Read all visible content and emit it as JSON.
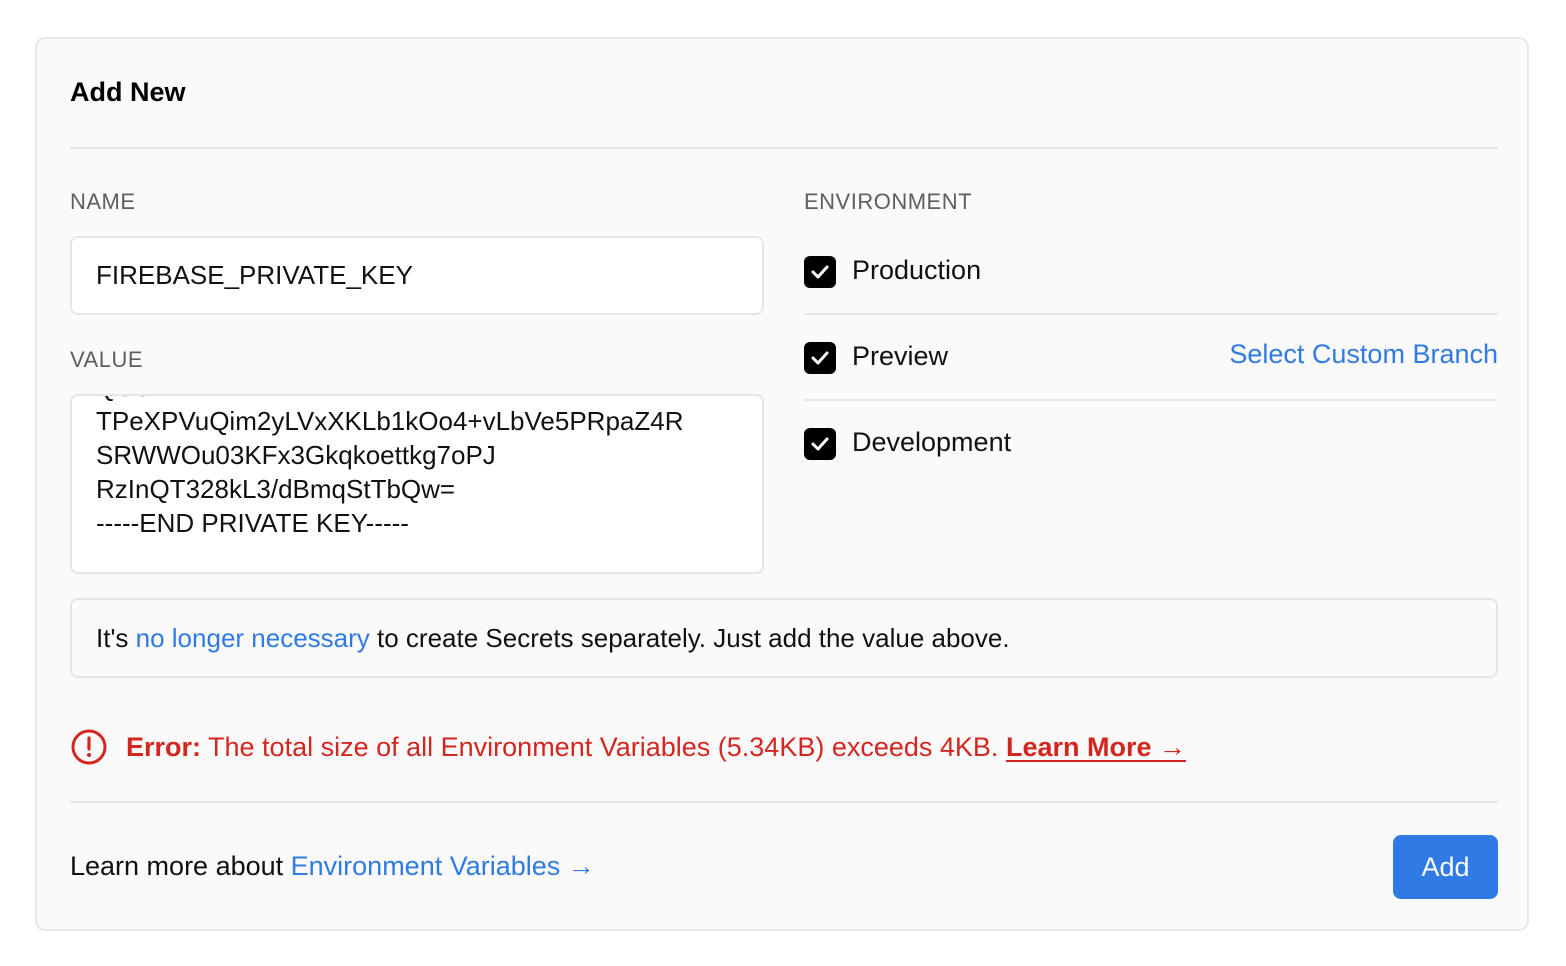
{
  "form": {
    "title": "Add New",
    "name_label": "NAME",
    "name_value": "FIREBASE_PRIVATE_KEY",
    "value_label": "VALUE",
    "value_lines": [
      "QUeD...",
      "TPeXPVuQim2yLVxXKLb1kOo4+vLbVe5PRpaZ4R",
      "SRWWOu03KFx3Gkqkoettkg7oPJ",
      "RzInQT328kL3/dBmqStTbQw=",
      "-----END PRIVATE KEY-----"
    ],
    "environment_label": "ENVIRONMENT",
    "environments": [
      {
        "label": "Production",
        "checked": true
      },
      {
        "label": "Preview",
        "checked": true
      },
      {
        "label": "Development",
        "checked": true
      }
    ],
    "custom_branch_label": "Select Custom Branch"
  },
  "notice": {
    "prefix": "It's ",
    "link": "no longer necessary",
    "suffix": " to create Secrets separately. Just add the value above."
  },
  "error": {
    "label": "Error:",
    "message": "The total size of all Environment Variables (5.34KB) exceeds 4KB.",
    "link": "Learn More →"
  },
  "footer": {
    "prefix": "Learn more about ",
    "link": "Environment Variables →",
    "add_label": "Add"
  },
  "colors": {
    "accent": "#2f7ae5",
    "error": "#d3261f"
  }
}
